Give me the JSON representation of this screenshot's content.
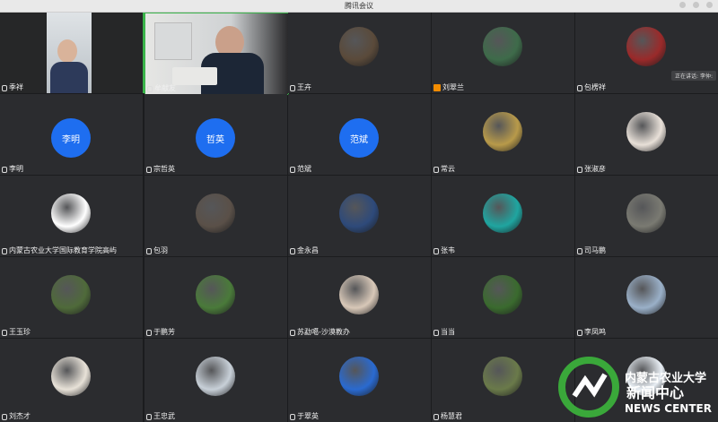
{
  "window": {
    "title": "腾讯会议"
  },
  "speaking_label": "正在讲话: 李仲:",
  "participants": [
    {
      "name": "季祥",
      "kind": "video1",
      "icon": "mic"
    },
    {
      "name": "牟献友",
      "kind": "video2",
      "icon": "mic"
    },
    {
      "name": "王卉",
      "kind": "photo",
      "color": "#5a4a3a",
      "icon": "mic"
    },
    {
      "name": "刘翠兰",
      "kind": "photo",
      "color": "#3e6b4a",
      "icon": "alert"
    },
    {
      "name": "包楞祥",
      "kind": "photo",
      "color": "#9a2a2a",
      "icon": "mic"
    },
    {
      "name": "李明",
      "kind": "initials",
      "initials": "李明",
      "icon": "mic"
    },
    {
      "name": "宗哲英",
      "kind": "initials",
      "initials": "哲英",
      "icon": "mic"
    },
    {
      "name": "范斌",
      "kind": "initials",
      "initials": "范斌",
      "icon": "mic"
    },
    {
      "name": "常云",
      "kind": "photo",
      "color": "#b89a4a",
      "icon": "mic"
    },
    {
      "name": "张淑彦",
      "kind": "photo",
      "color": "#e8e0d8",
      "icon": "mic"
    },
    {
      "name": "内蒙古农业大学国际教育学院高屿",
      "kind": "photo",
      "color": "#ffffff",
      "icon": "mic"
    },
    {
      "name": "包羽",
      "kind": "photo",
      "color": "#5a5048",
      "icon": "mic"
    },
    {
      "name": "金永昌",
      "kind": "photo",
      "color": "#2e4a7a",
      "icon": "mic"
    },
    {
      "name": "张韦",
      "kind": "photo",
      "color": "#1fa5a0",
      "icon": "mic"
    },
    {
      "name": "司马鹏",
      "kind": "photo",
      "color": "#7a7a72",
      "icon": "mic"
    },
    {
      "name": "王玉珍",
      "kind": "photo",
      "color": "#4f6a3a",
      "icon": "mic"
    },
    {
      "name": "于鹏芳",
      "kind": "photo",
      "color": "#4a7a3a",
      "icon": "mic"
    },
    {
      "name": "苏勐噶-沙漠教办",
      "kind": "photo",
      "color": "#d8c8b8",
      "icon": "mic"
    },
    {
      "name": "当当",
      "kind": "photo",
      "color": "#3a6a2e",
      "icon": "mic"
    },
    {
      "name": "李凤鸣",
      "kind": "photo",
      "color": "#9ab0c8",
      "icon": "mic"
    },
    {
      "name": "刘杰才",
      "kind": "photo",
      "color": "#e8e2d8",
      "icon": "mic"
    },
    {
      "name": "王忠武",
      "kind": "photo",
      "color": "#c8d0d8",
      "icon": "mic"
    },
    {
      "name": "于翠英",
      "kind": "photo",
      "color": "#2a6ad0",
      "icon": "mic"
    },
    {
      "name": "杨慧君",
      "kind": "photo",
      "color": "#6a7a4a",
      "icon": "mic"
    },
    {
      "name": "",
      "kind": "photo",
      "color": "#e8eef4",
      "icon": "mic"
    }
  ],
  "watermark": {
    "line1": "内蒙古农业大学",
    "line2": "新闻中心",
    "line3": "NEWS CENTER",
    "colors": {
      "green": "#3aa83a",
      "text": "#ffffff"
    }
  }
}
